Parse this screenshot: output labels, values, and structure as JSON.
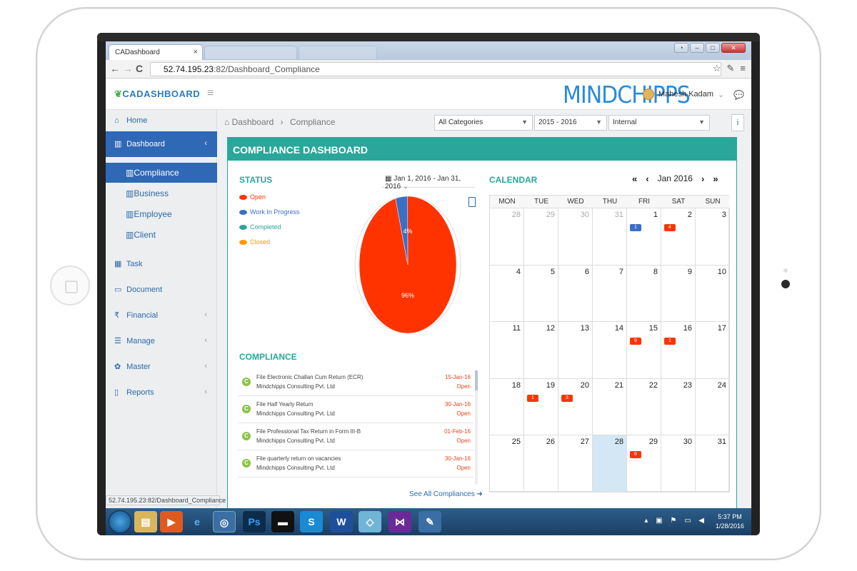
{
  "browser": {
    "tab_title": "CADashboard",
    "tab_close": "×",
    "url_host": "52.74.195.23",
    "url_path": ":82/Dashboard_Compliance",
    "status_url": "52.74.195.23:82/Dashboard_Compliance"
  },
  "header": {
    "logo": "CADASHBOARD",
    "brand": "MINDCHIPPS",
    "user_name": "Mahesh Kadam"
  },
  "sidebar": {
    "items": [
      {
        "label": "Home",
        "icon": "home-icon"
      },
      {
        "label": "Dashboard",
        "icon": "bar-chart-icon"
      },
      {
        "label": "Task",
        "icon": "calendar-icon"
      },
      {
        "label": "Document",
        "icon": "folder-icon"
      },
      {
        "label": "Financial",
        "icon": "rupee-icon"
      },
      {
        "label": "Manage",
        "icon": "list-icon"
      },
      {
        "label": "Master",
        "icon": "gear-icon"
      },
      {
        "label": "Reports",
        "icon": "file-icon"
      }
    ],
    "sub_items": [
      "Compliance",
      "Business",
      "Employee",
      "Client"
    ]
  },
  "toolbar": {
    "breadcrumb_root": "Dashboard",
    "breadcrumb_current": "Compliance",
    "category": "All Categories",
    "year": "2015 - 2016",
    "type": "Internal",
    "info": "i"
  },
  "panel": {
    "title": "COMPLIANCE DASHBOARD",
    "status_title": "STATUS",
    "date_range": "Jan 1, 2016 - Jan 31, 2016",
    "compliance_title": "COMPLIANCE",
    "see_all": "See All Compliances",
    "calendar_title": "CALENDAR"
  },
  "legend": [
    {
      "label": "Open",
      "color": "#ff3300"
    },
    {
      "label": "Work In Progress",
      "color": "#3a6fc4"
    },
    {
      "label": "Completed",
      "color": "#2aa79a"
    },
    {
      "label": "Closed",
      "color": "#ff9900"
    }
  ],
  "chart_data": {
    "type": "pie",
    "labels": [
      "Open",
      "Work In Progress"
    ],
    "values": [
      96,
      4
    ],
    "slice_labels": [
      "96%",
      "4%"
    ],
    "colors": [
      "#ff3300",
      "#3a6fc4"
    ]
  },
  "compliances": [
    {
      "name": "File Electronic Challan Cum Return (ECR)",
      "org": "Mindchipps Consulting Pvt. Ltd",
      "date": "15-Jan-16",
      "status": "Open",
      "badge": "C"
    },
    {
      "name": "File Half Yearly Return",
      "org": "Mindchipps Consulting Pvt. Ltd",
      "date": "30-Jan-16",
      "status": "Open",
      "badge": "C"
    },
    {
      "name": "File Professional Tax Return in Form III-B",
      "org": "Mindchipps Consulting Pvt. Ltd",
      "date": "01-Feb-16",
      "status": "Open",
      "badge": "C"
    },
    {
      "name": "File quarterly return on vacancies",
      "org": "Mindchipps Consulting Pvt. Ltd",
      "date": "30-Jan-16",
      "status": "Open",
      "badge": "C"
    }
  ],
  "calendar": {
    "month_label": "Jan 2016",
    "days_of_week": [
      "MON",
      "TUE",
      "WED",
      "THU",
      "FRI",
      "SAT",
      "SUN"
    ],
    "weeks": [
      [
        {
          "d": "28",
          "o": true
        },
        {
          "d": "29",
          "o": true
        },
        {
          "d": "30",
          "o": true
        },
        {
          "d": "31",
          "o": true
        },
        {
          "d": "1",
          "ev": "1",
          "evc": "#3a6fc4"
        },
        {
          "d": "2",
          "ev": "4",
          "evc": "#ff3300"
        },
        {
          "d": "3"
        }
      ],
      [
        {
          "d": "4"
        },
        {
          "d": "5"
        },
        {
          "d": "6"
        },
        {
          "d": "7"
        },
        {
          "d": "8"
        },
        {
          "d": "9"
        },
        {
          "d": "10"
        }
      ],
      [
        {
          "d": "11"
        },
        {
          "d": "12"
        },
        {
          "d": "13"
        },
        {
          "d": "14"
        },
        {
          "d": "15",
          "ev": "9",
          "evc": "#ff3300"
        },
        {
          "d": "16",
          "ev": "1",
          "evc": "#ff3300"
        },
        {
          "d": "17"
        }
      ],
      [
        {
          "d": "18"
        },
        {
          "d": "19",
          "ev": "1",
          "evc": "#ff3300"
        },
        {
          "d": "20",
          "ev": "3",
          "evc": "#ff3300"
        },
        {
          "d": "21"
        },
        {
          "d": "22"
        },
        {
          "d": "23"
        },
        {
          "d": "24"
        }
      ],
      [
        {
          "d": "25"
        },
        {
          "d": "26"
        },
        {
          "d": "27"
        },
        {
          "d": "28",
          "today": true
        },
        {
          "d": "29",
          "ev": "6",
          "evc": "#ff3300"
        },
        {
          "d": "30"
        },
        {
          "d": "31"
        }
      ]
    ]
  },
  "taskbar": {
    "time": "5:37 PM",
    "date": "1/28/2016"
  }
}
